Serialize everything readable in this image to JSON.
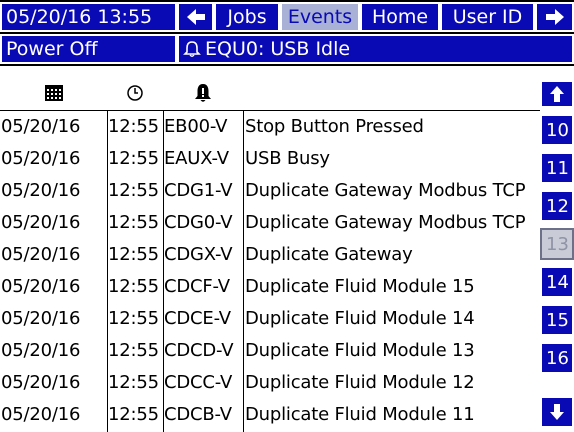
{
  "topbar": {
    "datetime": "05/20/16 13:55",
    "nav_back_icon": "arrow-left-icon",
    "tabs": [
      {
        "label": "Jobs",
        "active": false
      },
      {
        "label": "Events",
        "active": true
      },
      {
        "label": "Home",
        "active": false
      },
      {
        "label": "User ID",
        "active": false
      }
    ],
    "nav_forward_icon": "arrow-right-icon"
  },
  "statusbar": {
    "status": "Power Off",
    "alarm_icon": "bell-outline-icon",
    "message": "EQU0: USB Idle"
  },
  "table": {
    "header_icons": [
      "calendar-icon",
      "clock-icon",
      "bell-icon"
    ],
    "rows": [
      {
        "date": "05/20/16",
        "time": "12:55",
        "code": "EB00-V",
        "description": "Stop Button Pressed"
      },
      {
        "date": "05/20/16",
        "time": "12:55",
        "code": "EAUX-V",
        "description": "USB Busy"
      },
      {
        "date": "05/20/16",
        "time": "12:55",
        "code": "CDG1-V",
        "description": "Duplicate Gateway Modbus TCP"
      },
      {
        "date": "05/20/16",
        "time": "12:55",
        "code": "CDG0-V",
        "description": "Duplicate Gateway Modbus TCP"
      },
      {
        "date": "05/20/16",
        "time": "12:55",
        "code": "CDGX-V",
        "description": "Duplicate Gateway"
      },
      {
        "date": "05/20/16",
        "time": "12:55",
        "code": "CDCF-V",
        "description": "Duplicate Fluid Module 15"
      },
      {
        "date": "05/20/16",
        "time": "12:55",
        "code": "CDCE-V",
        "description": "Duplicate Fluid Module 14"
      },
      {
        "date": "05/20/16",
        "time": "12:55",
        "code": "CDCD-V",
        "description": "Duplicate Fluid Module 13"
      },
      {
        "date": "05/20/16",
        "time": "12:55",
        "code": "CDCC-V",
        "description": "Duplicate Fluid Module 12"
      },
      {
        "date": "05/20/16",
        "time": "12:55",
        "code": "CDCB-V",
        "description": "Duplicate Fluid Module 11"
      }
    ]
  },
  "pager": {
    "up_icon": "arrow-up-icon",
    "pages": [
      "10",
      "11",
      "12",
      "13",
      "14",
      "15",
      "16"
    ],
    "selected_page": "13",
    "down_icon": "arrow-down-icon"
  },
  "colors": {
    "accent": "#0a0ab4",
    "active_tab": "#aab1d6",
    "selected_page": "#c9ccd6"
  }
}
